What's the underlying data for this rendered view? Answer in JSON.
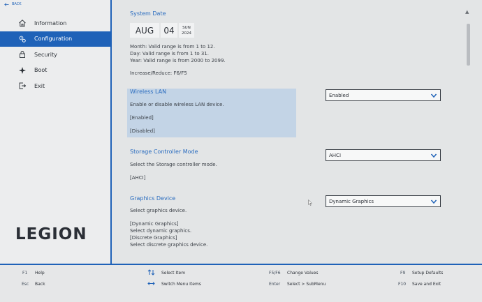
{
  "back_label": "BACK",
  "brand": {
    "logo_text": "LEGION"
  },
  "nav": {
    "items": [
      {
        "label": "Information",
        "icon": "home-icon"
      },
      {
        "label": "Configuration",
        "icon": "gears-icon",
        "active": true
      },
      {
        "label": "Security",
        "icon": "lock-icon"
      },
      {
        "label": "Boot",
        "icon": "boot-icon"
      },
      {
        "label": "Exit",
        "icon": "exit-icon"
      }
    ]
  },
  "system_date": {
    "title": "System Date",
    "month": "AUG",
    "day": "04",
    "weekday": "SUN",
    "year": "2024",
    "help": [
      "Month: Valid range is from 1 to 12.",
      "Day: Valid range is from 1 to 31.",
      "Year: Valid range is from 2000 to 2099."
    ],
    "hint": "Increase/Reduce: F6/F5"
  },
  "wireless_lan": {
    "title": "Wireless LAN",
    "description": "Enable or disable wireless LAN device.",
    "options": [
      "[Enabled]",
      "[Disabled]"
    ],
    "value": "Enabled"
  },
  "storage": {
    "title": "Storage Controller Mode",
    "description": "Select the Storage controller mode.",
    "options": [
      "[AHCI]"
    ],
    "value": "AHCI"
  },
  "graphics": {
    "title": "Graphics Device",
    "description": "Select graphics device.",
    "lines": [
      "[Dynamic Graphics]",
      "Select dynamic graphics.",
      "[Discrete Graphics]",
      "Select discrete graphics device."
    ],
    "value": "Dynamic Graphics"
  },
  "footer": {
    "help": {
      "key": "F1",
      "label": "Help"
    },
    "esc": {
      "key": "Esc",
      "label": "Back"
    },
    "select_item": {
      "label": "Select Item"
    },
    "switch_menu": {
      "label": "Switch Menu Items"
    },
    "change_values": {
      "key": "F5/F6",
      "label": "Change Values"
    },
    "submenu": {
      "key": "Enter",
      "label": "Select > SubMenu"
    },
    "setup_defaults": {
      "key": "F9",
      "label": "Setup Defaults"
    },
    "save_exit": {
      "key": "F10",
      "label": "Save and Exit"
    }
  },
  "colors": {
    "accent": "#1f62b8",
    "highlight": "#c3d4e6",
    "background": "#e3e5e6"
  }
}
